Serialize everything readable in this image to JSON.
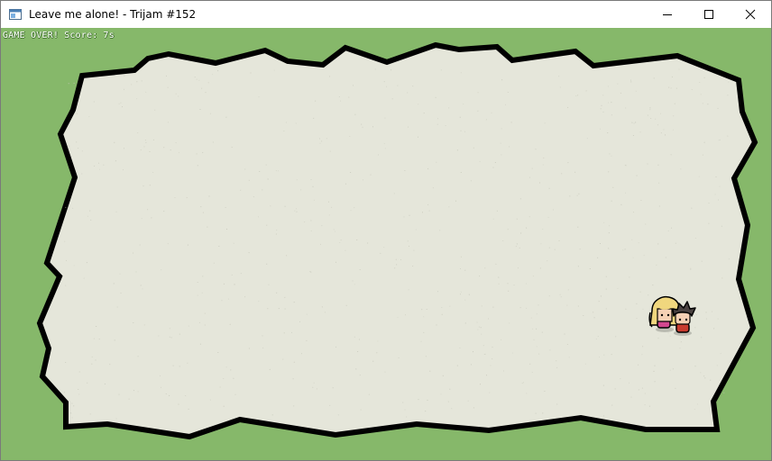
{
  "window": {
    "title": "Leave me alone! - Trijam #152",
    "app_icon": "app-window-icon",
    "buttons": [
      "minimize-icon",
      "maximize-icon",
      "close-icon"
    ]
  },
  "hud": {
    "status": "GAME OVER!",
    "score_label": "Score:",
    "score_value": "7s"
  },
  "colors": {
    "grass": "#86b86a",
    "ground": "#e5e6da",
    "outline": "#000000",
    "speck": "#c9cabd",
    "girl_hair": "#f0d77e",
    "girl_dress": "#d2478f",
    "boy_hair": "#4a4241",
    "boy_shirt": "#c83b2f",
    "skin": "#f6d1b5"
  },
  "characters": [
    {
      "name": "blonde-girl-character"
    },
    {
      "name": "dark-hair-boy-character"
    }
  ]
}
